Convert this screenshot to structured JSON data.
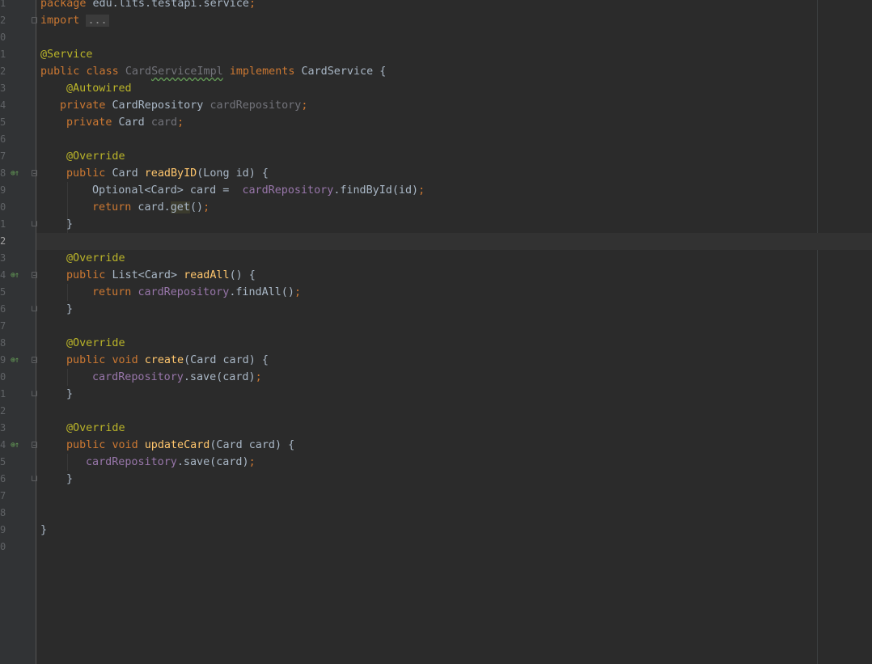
{
  "editor": {
    "line_numbers": [
      "1",
      "2",
      "0",
      "1",
      "2",
      "3",
      "4",
      "5",
      "6",
      "7",
      "8",
      "9",
      "0",
      "1",
      "2",
      "3",
      "4",
      "5",
      "6",
      "7",
      "8",
      "9",
      "0",
      "1",
      "2",
      "3",
      "4",
      "5",
      "6",
      "7",
      "8",
      "9",
      "0"
    ],
    "tokens": {
      "package_kw": "package",
      "package_name": " edu.lits.testapi.service",
      "semicolon": ";",
      "import_kw": "import",
      "import_fold": "...",
      "service_ann": "@Service",
      "public_kw": "public",
      "class_kw": "class",
      "class_name_prefix": "Card",
      "class_name_warn": "ServiceImpl",
      "implements_kw": "implements",
      "interface_name": "CardService {",
      "autowired_ann": "@Autowired",
      "private_kw": "private",
      "repo_type": "CardRepository",
      "repo_field": "cardRepository",
      "card_type": "Card",
      "card_field": "card",
      "override_ann": "@Override",
      "readbyid_return": "Card",
      "readbyid_name": "readByID",
      "readbyid_params": "(Long id) {",
      "optional_decl": "Optional<Card> card = ",
      "findbyid_call": ".findById(id)",
      "return_kw": "return",
      "card_var": " card.",
      "get_call": "get",
      "get_parens": "()",
      "close_brace": "}",
      "list_type": "List<Card>",
      "readall_name": "readAll",
      "empty_params": "() {",
      "findall_call": ".findAll()",
      "void_kw": "void",
      "create_name": "create",
      "card_param": "(Card card) {",
      "save_call": ".save(card)",
      "updatecard_name": "updateCard",
      "class_close": "}"
    }
  },
  "gutter_icons": {
    "override": "⊕↑"
  },
  "colors": {
    "background": "#2b2b2b",
    "gutter": "#313335",
    "keyword": "#cc7832",
    "annotation": "#bbb529",
    "field": "#9876aa",
    "method": "#ffc66d",
    "text": "#a9b7c6",
    "unused": "#72737a"
  }
}
